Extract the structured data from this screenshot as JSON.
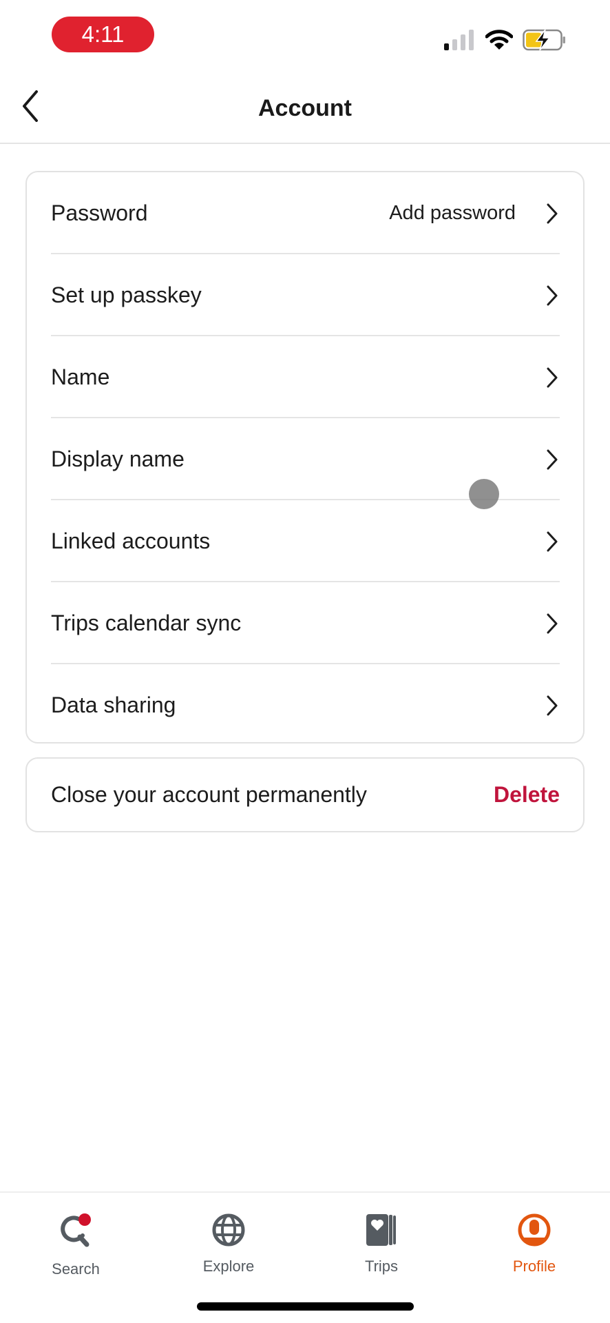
{
  "status_bar": {
    "time": "4:11",
    "signal_icon": "cellular-signal-icon",
    "wifi_icon": "wifi-icon",
    "battery_icon": "battery-charging-icon",
    "colors": {
      "time_pill": "#e0222f",
      "battery_fill": "#f2c416"
    }
  },
  "header": {
    "back_icon": "chevron-left-icon",
    "title": "Account"
  },
  "settings": {
    "rows": [
      {
        "label": "Password",
        "value": "Add password",
        "icon": "chevron-right-icon"
      },
      {
        "label": "Set up passkey",
        "value": "",
        "icon": "chevron-right-icon"
      },
      {
        "label": "Name",
        "value": "",
        "icon": "chevron-right-icon"
      },
      {
        "label": "Display name",
        "value": "",
        "icon": "chevron-right-icon"
      },
      {
        "label": "Linked accounts",
        "value": "",
        "icon": "chevron-right-icon"
      },
      {
        "label": "Trips calendar sync",
        "value": "",
        "icon": "chevron-right-icon"
      },
      {
        "label": "Data sharing",
        "value": "",
        "icon": "chevron-right-icon"
      }
    ]
  },
  "close_account": {
    "label": "Close your account permanently",
    "action": "Delete",
    "action_color": "#c0143c"
  },
  "tab_bar": {
    "tabs": [
      {
        "label": "Search",
        "icon": "search-icon",
        "active": false,
        "badge": true
      },
      {
        "label": "Explore",
        "icon": "globe-icon",
        "active": false
      },
      {
        "label": "Trips",
        "icon": "trips-heart-cards-icon",
        "active": false
      },
      {
        "label": "Profile",
        "icon": "profile-icon",
        "active": true
      }
    ],
    "colors": {
      "inactive": "#555b61",
      "active": "#e2560f",
      "badge": "#d0112b"
    }
  }
}
